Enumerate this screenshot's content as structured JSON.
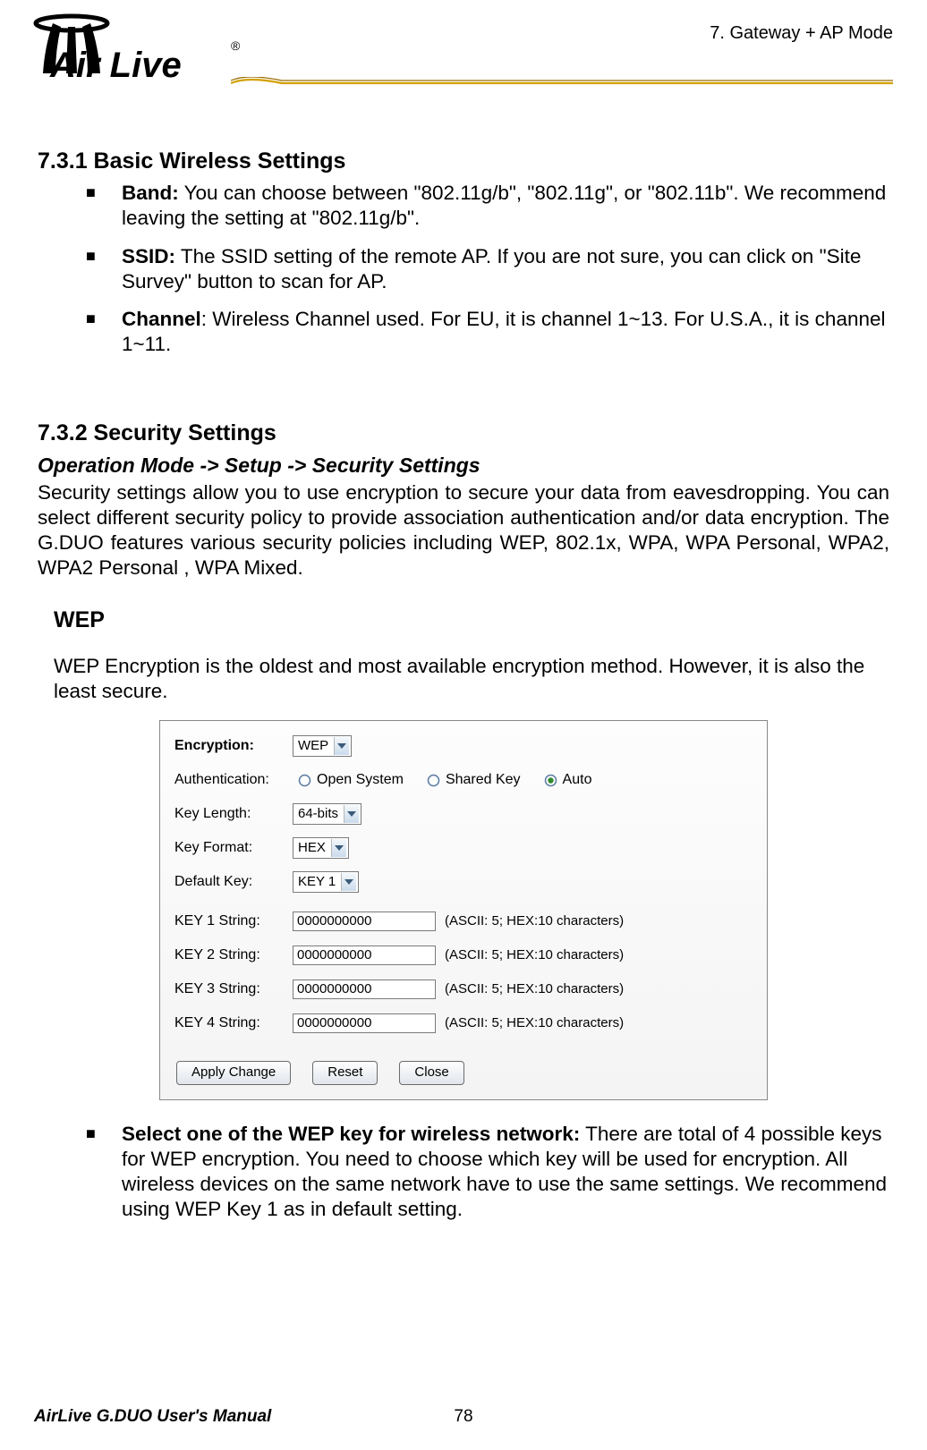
{
  "header": {
    "brand_primary": "Air Live",
    "brand_mark": "®",
    "breadcrumb": "7.  Gateway  +  AP    Mode"
  },
  "section_731": {
    "heading": "7.3.1 Basic Wireless Settings",
    "items": [
      {
        "label": "Band:",
        "text": "    You can choose between \"802.11g/b\", \"802.11g\", or \"802.11b\".    We recommend leaving the setting at \"802.11g/b\"."
      },
      {
        "label": "SSID:",
        "text": "    The SSID setting of the remote AP.    If you are not sure, you can click on \"Site Survey\" button to scan for AP."
      },
      {
        "label": "Channel",
        "colon": ":",
        "text": "    Wireless Channel used.    For EU, it is channel 1~13.    For U.S.A., it is channel 1~11."
      }
    ]
  },
  "section_732": {
    "heading": "7.3.2 Security Settings",
    "path": "Operation Mode -> Setup -> Security Settings",
    "para": "Security  settings  allow  you  to  use  encryption  to  secure  your  data  from  eavesdropping.  You can select different security policy to provide association authentication and/or data encryption.   The G.DUO features various security policies including WEP, 802.1x, WPA, WPA Personal, WPA2, WPA2 Personal , WPA Mixed."
  },
  "wep": {
    "title": "WEP",
    "intro": "WEP Encryption is the oldest and most available encryption method.    However, it is also the least secure."
  },
  "dialog": {
    "encryption_label": "Encryption:",
    "encryption_value": "WEP",
    "auth_label": "Authentication:",
    "auth_options": {
      "open": "Open System",
      "shared": "Shared Key",
      "auto": "Auto"
    },
    "auth_selected": "auto",
    "keylen_label": "Key Length:",
    "keylen_value": "64-bits",
    "keyfmt_label": "Key Format:",
    "keyfmt_value": "HEX",
    "defkey_label": "Default Key:",
    "defkey_value": "KEY 1",
    "keys": [
      {
        "label": "KEY 1 String:",
        "value": "0000000000",
        "hint": "(ASCII: 5; HEX:10 characters)"
      },
      {
        "label": "KEY 2 String:",
        "value": "0000000000",
        "hint": "(ASCII: 5; HEX:10 characters)"
      },
      {
        "label": "KEY 3 String:",
        "value": "0000000000",
        "hint": "(ASCII: 5; HEX:10 characters)"
      },
      {
        "label": "KEY 4 String:",
        "value": "0000000000",
        "hint": "(ASCII: 5; HEX:10 characters)"
      }
    ],
    "buttons": {
      "apply": "Apply Change",
      "reset": "Reset",
      "close": "Close"
    }
  },
  "post_bullet": {
    "label": "Select one of the WEP key for wireless network:",
    "text": "    There are total of 4 possible keys for WEP encryption.    You need to choose which key will be used for encryption.    All wireless devices on the same network have to use the same settings.    We recommend using WEP Key 1 as in default setting."
  },
  "footer": {
    "manual": "AirLive G.DUO User's Manual",
    "page": "78"
  }
}
